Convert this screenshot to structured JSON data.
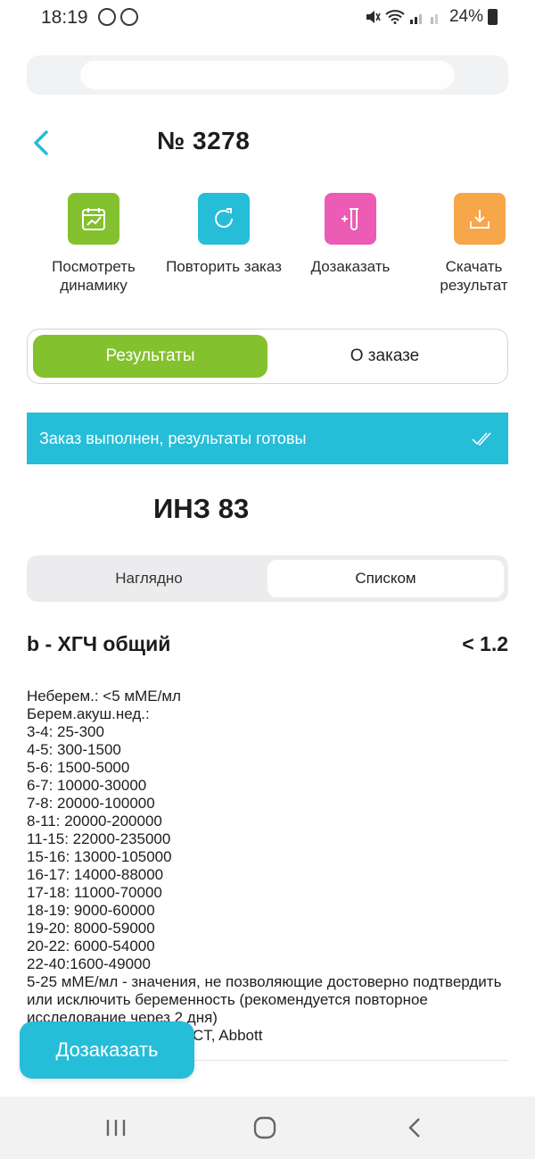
{
  "status_bar": {
    "time": "18:19",
    "battery_text": "24%"
  },
  "header": {
    "order_number": "№ 3278"
  },
  "actions": [
    {
      "label": "Посмотреть динамику",
      "color": "#84c12e",
      "icon": "chart-icon"
    },
    {
      "label": "Повторить заказ",
      "color": "#26bdd8",
      "icon": "refresh-icon"
    },
    {
      "label": "Дозаказать",
      "color": "#ec5bb4",
      "icon": "test-tube-plus-icon"
    },
    {
      "label": "Скачать результат",
      "color": "#f7a64a",
      "icon": "download-icon"
    }
  ],
  "tabs": {
    "results": "Результаты",
    "about_order": "О заказе",
    "active": "results"
  },
  "banner": {
    "text": "Заказ выполнен, результаты готовы"
  },
  "test": {
    "code": "ИНЗ 83",
    "name": "b - ХГЧ общий",
    "value": "< 1.2"
  },
  "view_toggle": {
    "visual": "Наглядно",
    "list": "Списком",
    "active": "list"
  },
  "reference": {
    "lines": [
      "Неберем.: <5 мМЕ/мл",
      "Берем.акуш.нед.:",
      "3-4: 25-300",
      "4-5: 300-1500",
      "5-6: 1500-5000",
      "6-7: 10000-30000",
      "7-8: 20000-100000",
      "8-11: 20000-200000",
      "11-15: 22000-235000",
      "15-16: 13000-105000",
      "16-17: 14000-88000",
      "17-18: 11000-70000",
      "18-19: 9000-60000",
      "19-20: 8000-59000",
      "20-22: 6000-54000",
      "22-40:1600-49000"
    ],
    "note": "5-25 мМЕ/мл - значения, не позволяющие достоверно подтвердить или исключить беременность (рекомендуется повторное исследование через 2 дня)",
    "method_tail": "CT, Abbott"
  },
  "fab": {
    "label": "Дозаказать"
  },
  "colors": {
    "green": "#84c12e",
    "cyan": "#26bdd8",
    "pink": "#ec5bb4",
    "orange": "#f7a64a"
  }
}
